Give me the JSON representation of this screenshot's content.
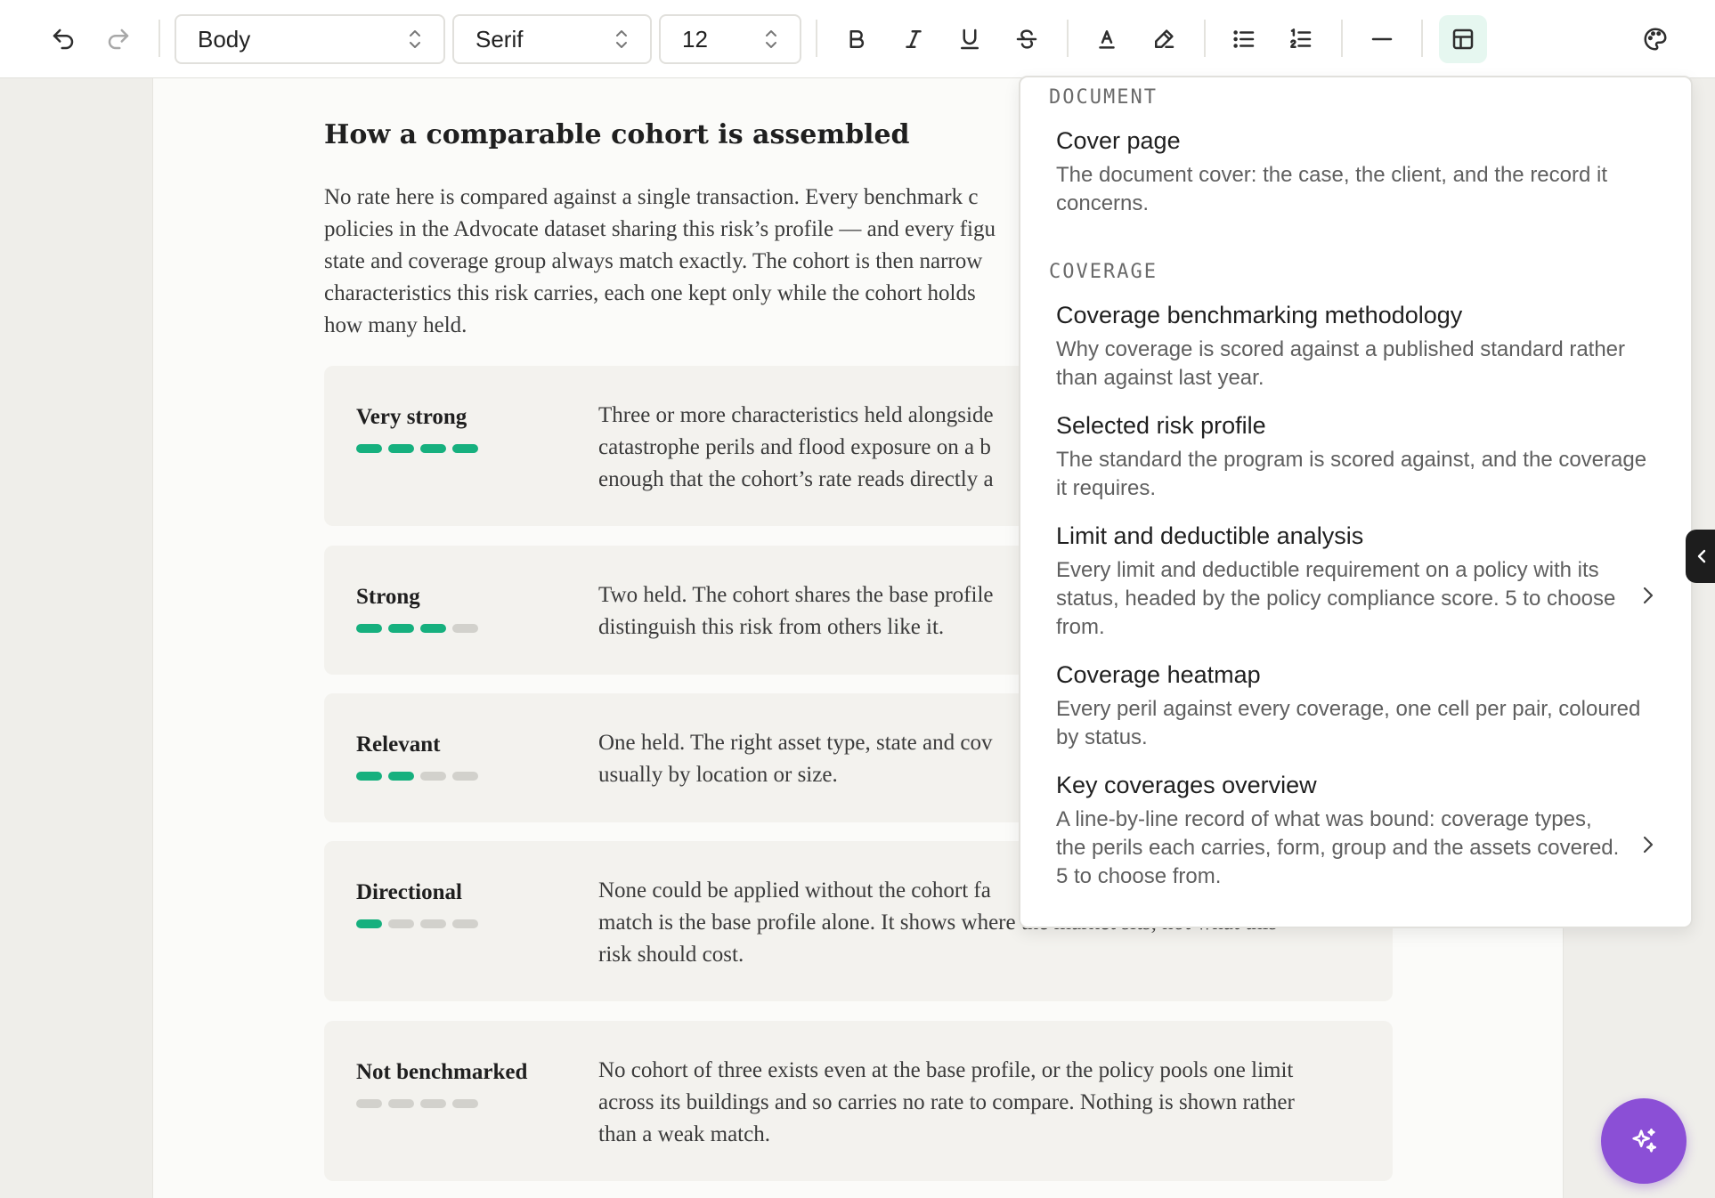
{
  "toolbar": {
    "style_value": "Body",
    "font_value": "Serif",
    "size_value": "12"
  },
  "document": {
    "heading": "How a comparable cohort is assembled",
    "para_lines": [
      "No rate here is compared against a single transaction. Every benchmark c",
      "policies in the Advocate dataset sharing this risk’s profile — and every figu",
      "state and coverage group always match exactly. The cohort is then narrow",
      "characteristics this risk carries, each one kept only while the cohort holds",
      "how many held."
    ],
    "cards": [
      {
        "label": "Very strong",
        "level": 4,
        "lines": [
          "Three or more characteristics held alongside",
          "catastrophe perils and flood exposure on a b",
          "enough that the cohort’s rate reads directly a"
        ]
      },
      {
        "label": "Strong",
        "level": 3,
        "lines": [
          "Two held. The cohort shares the base profile",
          "distinguish this risk from others like it."
        ]
      },
      {
        "label": "Relevant",
        "level": 2,
        "lines": [
          "One held. The right asset type, state and cov",
          "usually by location or size."
        ]
      },
      {
        "label": "Directional",
        "level": 1,
        "lines": [
          "None could be applied without the cohort fa",
          "match is the base profile alone. It shows where the market sits, not what this",
          "risk should cost."
        ]
      },
      {
        "label": "Not benchmarked",
        "level": 0,
        "lines": [
          "No cohort of three exists even at the base profile, or the policy pools one limit",
          "across its buildings and so carries no rate to compare. Nothing is shown rather",
          "than a weak match."
        ]
      }
    ]
  },
  "panel": {
    "groups": [
      {
        "heading": "DOCUMENT",
        "items": [
          {
            "title": "Cover page",
            "desc": "The document cover: the case, the client, and the record it concerns."
          }
        ]
      },
      {
        "heading": "COVERAGE",
        "items": [
          {
            "title": "Coverage benchmarking methodology",
            "desc": "Why coverage is scored against a published standard rather than against last year."
          },
          {
            "title": "Selected risk profile",
            "desc": "The standard the program is scored against, and the coverage it requires."
          },
          {
            "title": "Limit and deductible analysis",
            "desc": "Every limit and deductible requirement on a policy with its status, headed by the policy compliance score. 5 to choose from."
          },
          {
            "title": "Coverage heatmap",
            "desc": "Every peril against every coverage, one cell per pair, coloured by status."
          },
          {
            "title": "Key coverages overview",
            "desc": "A line-by-line record of what was bound: coverage types, the perils each carries, form, group and the assets covered. 5 to choose from."
          }
        ]
      }
    ]
  }
}
